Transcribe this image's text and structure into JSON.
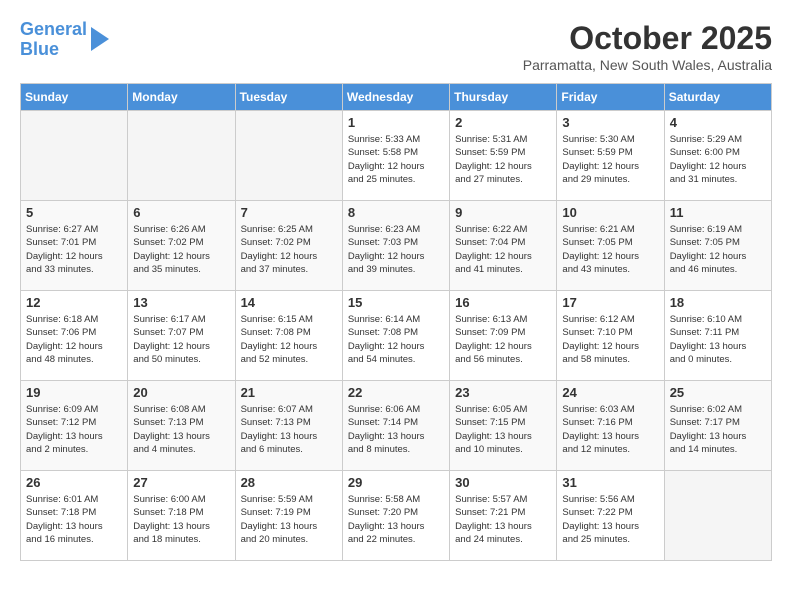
{
  "header": {
    "logo_line1": "General",
    "logo_line2": "Blue",
    "title": "October 2025",
    "location": "Parramatta, New South Wales, Australia"
  },
  "days_of_week": [
    "Sunday",
    "Monday",
    "Tuesday",
    "Wednesday",
    "Thursday",
    "Friday",
    "Saturday"
  ],
  "weeks": [
    [
      {
        "num": "",
        "info": ""
      },
      {
        "num": "",
        "info": ""
      },
      {
        "num": "",
        "info": ""
      },
      {
        "num": "1",
        "info": "Sunrise: 5:33 AM\nSunset: 5:58 PM\nDaylight: 12 hours\nand 25 minutes."
      },
      {
        "num": "2",
        "info": "Sunrise: 5:31 AM\nSunset: 5:59 PM\nDaylight: 12 hours\nand 27 minutes."
      },
      {
        "num": "3",
        "info": "Sunrise: 5:30 AM\nSunset: 5:59 PM\nDaylight: 12 hours\nand 29 minutes."
      },
      {
        "num": "4",
        "info": "Sunrise: 5:29 AM\nSunset: 6:00 PM\nDaylight: 12 hours\nand 31 minutes."
      }
    ],
    [
      {
        "num": "5",
        "info": "Sunrise: 6:27 AM\nSunset: 7:01 PM\nDaylight: 12 hours\nand 33 minutes."
      },
      {
        "num": "6",
        "info": "Sunrise: 6:26 AM\nSunset: 7:02 PM\nDaylight: 12 hours\nand 35 minutes."
      },
      {
        "num": "7",
        "info": "Sunrise: 6:25 AM\nSunset: 7:02 PM\nDaylight: 12 hours\nand 37 minutes."
      },
      {
        "num": "8",
        "info": "Sunrise: 6:23 AM\nSunset: 7:03 PM\nDaylight: 12 hours\nand 39 minutes."
      },
      {
        "num": "9",
        "info": "Sunrise: 6:22 AM\nSunset: 7:04 PM\nDaylight: 12 hours\nand 41 minutes."
      },
      {
        "num": "10",
        "info": "Sunrise: 6:21 AM\nSunset: 7:05 PM\nDaylight: 12 hours\nand 43 minutes."
      },
      {
        "num": "11",
        "info": "Sunrise: 6:19 AM\nSunset: 7:05 PM\nDaylight: 12 hours\nand 46 minutes."
      }
    ],
    [
      {
        "num": "12",
        "info": "Sunrise: 6:18 AM\nSunset: 7:06 PM\nDaylight: 12 hours\nand 48 minutes."
      },
      {
        "num": "13",
        "info": "Sunrise: 6:17 AM\nSunset: 7:07 PM\nDaylight: 12 hours\nand 50 minutes."
      },
      {
        "num": "14",
        "info": "Sunrise: 6:15 AM\nSunset: 7:08 PM\nDaylight: 12 hours\nand 52 minutes."
      },
      {
        "num": "15",
        "info": "Sunrise: 6:14 AM\nSunset: 7:08 PM\nDaylight: 12 hours\nand 54 minutes."
      },
      {
        "num": "16",
        "info": "Sunrise: 6:13 AM\nSunset: 7:09 PM\nDaylight: 12 hours\nand 56 minutes."
      },
      {
        "num": "17",
        "info": "Sunrise: 6:12 AM\nSunset: 7:10 PM\nDaylight: 12 hours\nand 58 minutes."
      },
      {
        "num": "18",
        "info": "Sunrise: 6:10 AM\nSunset: 7:11 PM\nDaylight: 13 hours\nand 0 minutes."
      }
    ],
    [
      {
        "num": "19",
        "info": "Sunrise: 6:09 AM\nSunset: 7:12 PM\nDaylight: 13 hours\nand 2 minutes."
      },
      {
        "num": "20",
        "info": "Sunrise: 6:08 AM\nSunset: 7:13 PM\nDaylight: 13 hours\nand 4 minutes."
      },
      {
        "num": "21",
        "info": "Sunrise: 6:07 AM\nSunset: 7:13 PM\nDaylight: 13 hours\nand 6 minutes."
      },
      {
        "num": "22",
        "info": "Sunrise: 6:06 AM\nSunset: 7:14 PM\nDaylight: 13 hours\nand 8 minutes."
      },
      {
        "num": "23",
        "info": "Sunrise: 6:05 AM\nSunset: 7:15 PM\nDaylight: 13 hours\nand 10 minutes."
      },
      {
        "num": "24",
        "info": "Sunrise: 6:03 AM\nSunset: 7:16 PM\nDaylight: 13 hours\nand 12 minutes."
      },
      {
        "num": "25",
        "info": "Sunrise: 6:02 AM\nSunset: 7:17 PM\nDaylight: 13 hours\nand 14 minutes."
      }
    ],
    [
      {
        "num": "26",
        "info": "Sunrise: 6:01 AM\nSunset: 7:18 PM\nDaylight: 13 hours\nand 16 minutes."
      },
      {
        "num": "27",
        "info": "Sunrise: 6:00 AM\nSunset: 7:18 PM\nDaylight: 13 hours\nand 18 minutes."
      },
      {
        "num": "28",
        "info": "Sunrise: 5:59 AM\nSunset: 7:19 PM\nDaylight: 13 hours\nand 20 minutes."
      },
      {
        "num": "29",
        "info": "Sunrise: 5:58 AM\nSunset: 7:20 PM\nDaylight: 13 hours\nand 22 minutes."
      },
      {
        "num": "30",
        "info": "Sunrise: 5:57 AM\nSunset: 7:21 PM\nDaylight: 13 hours\nand 24 minutes."
      },
      {
        "num": "31",
        "info": "Sunrise: 5:56 AM\nSunset: 7:22 PM\nDaylight: 13 hours\nand 25 minutes."
      },
      {
        "num": "",
        "info": ""
      }
    ]
  ]
}
